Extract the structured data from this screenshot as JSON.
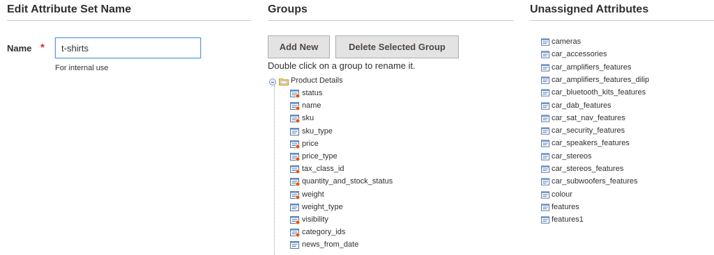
{
  "left": {
    "heading": "Edit Attribute Set Name",
    "name_label": "Name",
    "required_marker": "*",
    "name_value": "t-shirts",
    "name_note": "For internal use"
  },
  "groups": {
    "heading": "Groups",
    "add_new_label": "Add New",
    "delete_label": "Delete Selected Group",
    "hint": "Double click on a group to rename it.",
    "root_label": "Product Details",
    "attributes": [
      {
        "label": "status",
        "system": true
      },
      {
        "label": "name",
        "system": true
      },
      {
        "label": "sku",
        "system": true
      },
      {
        "label": "sku_type",
        "system": false
      },
      {
        "label": "price",
        "system": true
      },
      {
        "label": "price_type",
        "system": true
      },
      {
        "label": "tax_class_id",
        "system": true
      },
      {
        "label": "quantity_and_stock_status",
        "system": true
      },
      {
        "label": "weight",
        "system": true
      },
      {
        "label": "weight_type",
        "system": false
      },
      {
        "label": "visibility",
        "system": true
      },
      {
        "label": "category_ids",
        "system": true
      },
      {
        "label": "news_from_date",
        "system": false
      }
    ]
  },
  "unassigned": {
    "heading": "Unassigned Attributes",
    "items": [
      "cameras",
      "car_accessories",
      "car_amplifiers_features",
      "car_amplifiers_features_dilip",
      "car_bluetooth_kits_features",
      "car_dab_features",
      "car_sat_nav_features",
      "car_security_features",
      "car_speakers_features",
      "car_stereos",
      "car_stereos_features",
      "car_subwoofers_features",
      "colour",
      "features",
      "features1"
    ]
  },
  "colors": {
    "required": "#e22626",
    "input_focus": "#5b9bd5",
    "button_bg": "#e3e3e3",
    "system_badge": "#eb5202"
  },
  "icons": {
    "tree_toggle": "minus-circle-icon",
    "group": "folder-icon",
    "attribute": "attribute-doc-icon",
    "system_attribute": "system-attribute-icon"
  }
}
